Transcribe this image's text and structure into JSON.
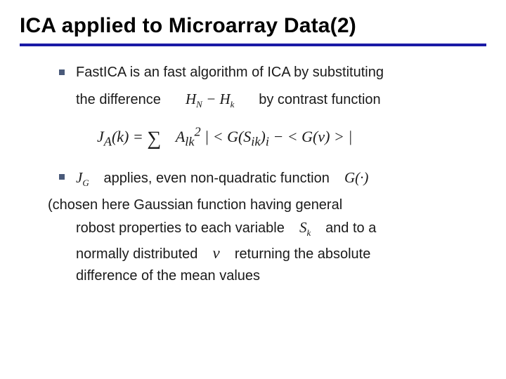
{
  "title": "ICA applied to Microarray Data(2)",
  "bullets": [
    {
      "line1": "FastICA is an fast algorithm of ICA by substituting",
      "line2a": "the difference",
      "math_diff_a": "H",
      "math_diff_a_sub": "N",
      "math_diff_mid": " − ",
      "math_diff_b": "H",
      "math_diff_b_sub": "k",
      "line2b": "by contrast function"
    },
    {
      "math_jg": "J",
      "math_jg_sub": "G",
      "line1": "applies, even non-quadratic function",
      "math_g": "G(·)"
    }
  ],
  "formula": {
    "lhs_a": "J",
    "lhs_a_sub": "A",
    "lhs_arg": "(k) = ",
    "sum": "∑",
    "A": "A",
    "A_sub": "lk",
    "A_sup": "2",
    "bar": " | < ",
    "G1": "G(S",
    "G1_sub": "ik",
    "G1_close": ")",
    "i_sub": "i",
    "mid": " − < ",
    "G2": "G(v)",
    "close": " > |"
  },
  "paragraph": {
    "p1": "(chosen here Gaussian function having general",
    "p2a": "robost properties to each variable",
    "math_sk": "S",
    "math_sk_sub": "k",
    "p2b": "and to a",
    "p3a": "normally distributed",
    "math_v": "v",
    "p3b": "returning the absolute",
    "p4": "difference of the mean values"
  }
}
